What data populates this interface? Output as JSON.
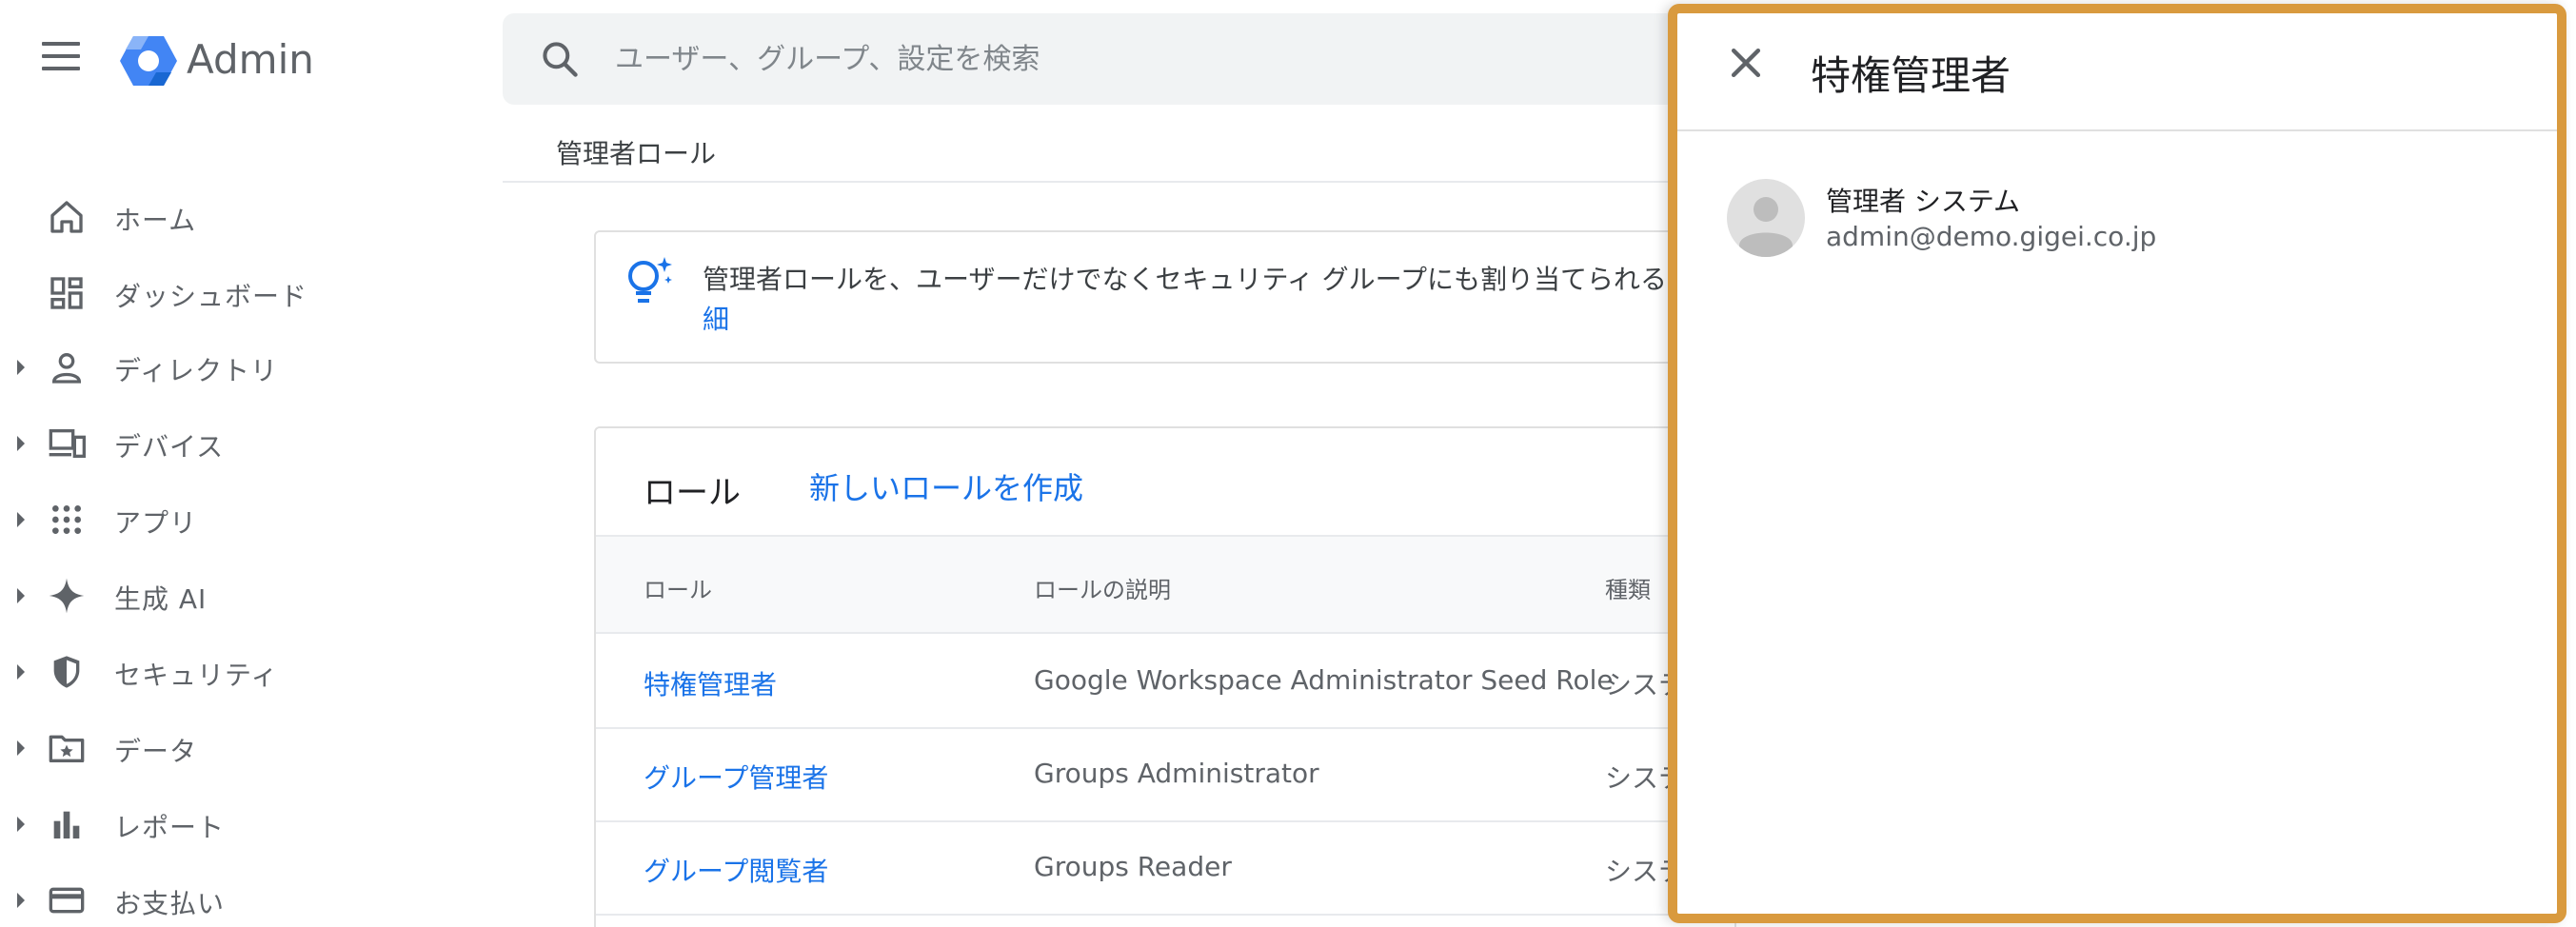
{
  "header": {
    "brand": "Admin",
    "search_placeholder": "ユーザー、グループ、設定を検索"
  },
  "sidebar": {
    "items": [
      {
        "label": "ホーム",
        "icon": "home-icon",
        "expandable": false
      },
      {
        "label": "ダッシュボード",
        "icon": "dashboard-icon",
        "expandable": false
      },
      {
        "label": "ディレクトリ",
        "icon": "person-icon",
        "expandable": true
      },
      {
        "label": "デバイス",
        "icon": "devices-icon",
        "expandable": true
      },
      {
        "label": "アプリ",
        "icon": "apps-grid-icon",
        "expandable": true
      },
      {
        "label": "生成 AI",
        "icon": "sparkle-icon",
        "expandable": true
      },
      {
        "label": "セキュリティ",
        "icon": "shield-icon",
        "expandable": true
      },
      {
        "label": "データ",
        "icon": "folder-star-icon",
        "expandable": true
      },
      {
        "label": "レポート",
        "icon": "bar-chart-icon",
        "expandable": true
      },
      {
        "label": "お支払い",
        "icon": "credit-card-icon",
        "expandable": true
      }
    ]
  },
  "main": {
    "breadcrumb": "管理者ロール",
    "banner": {
      "text": "管理者ロールを、ユーザーだけでなくセキュリティ グループにも割り当てられるよ",
      "link": "細"
    },
    "roles": {
      "title": "ロール",
      "create_link": "新しいロールを作成",
      "columns": [
        "ロール",
        "ロールの説明",
        "種類"
      ],
      "rows": [
        {
          "name": "特権管理者",
          "description": "Google Workspace Administrator Seed Role",
          "type": "システ"
        },
        {
          "name": "グループ管理者",
          "description": "Groups Administrator",
          "type": "システ"
        },
        {
          "name": "グループ閲覧者",
          "description": "Groups Reader",
          "type": "システ"
        }
      ]
    }
  },
  "panel": {
    "title": "特権管理者",
    "user": {
      "name": "管理者 システム",
      "email": "admin@demo.gigei.co.jp"
    }
  },
  "colors": {
    "panel_border": "#d99a3e",
    "link": "#1a73e8",
    "icon": "#5f6368"
  }
}
